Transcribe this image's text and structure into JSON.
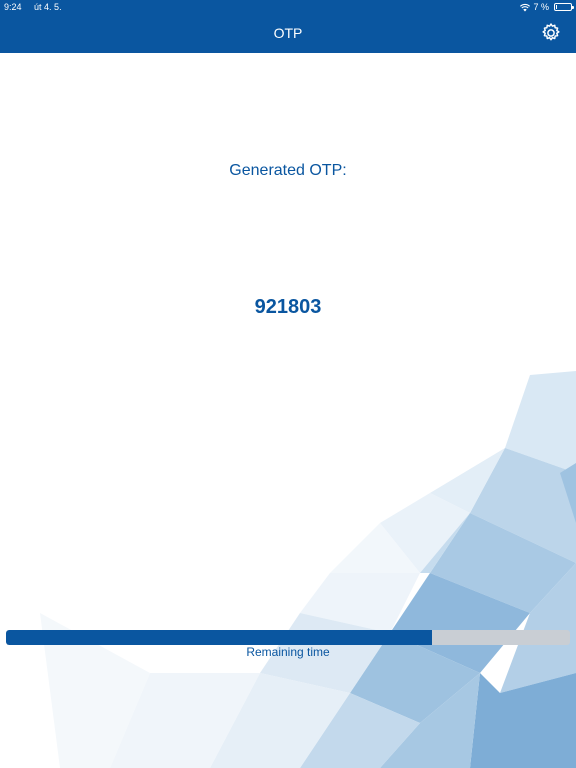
{
  "status_bar": {
    "time": "9:24",
    "date": "út 4. 5.",
    "battery_text": "7 %",
    "battery_level": 0.07
  },
  "nav": {
    "title": "OTP",
    "settings_icon": "gear-icon"
  },
  "otp": {
    "label": "Generated OTP:",
    "code": "921803"
  },
  "timer": {
    "remaining_fraction": 0.755,
    "label": "Remaining time"
  },
  "colors": {
    "brand_blue": "#0a56a0",
    "track_gray": "#c9ced4"
  }
}
